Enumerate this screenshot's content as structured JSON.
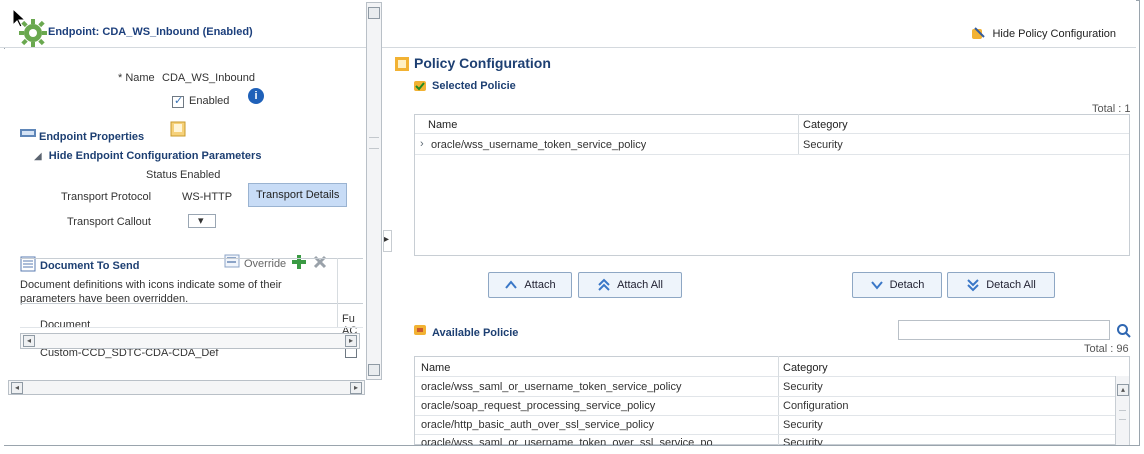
{
  "header": {
    "endpoint_title": "Endpoint: CDA_WS_Inbound (Enabled)",
    "hide_policy_label": "Hide Policy Configuration"
  },
  "left": {
    "name_label": "* Name",
    "name_value": "CDA_WS_Inbound",
    "enabled_label": "Enabled",
    "endpoint_properties": "Endpoint Properties",
    "hide_config": "Hide Endpoint Configuration Parameters",
    "status_label": "Status",
    "status_value": "Enabled",
    "transport_protocol_label": "Transport Protocol",
    "transport_protocol_value": "WS-HTTP",
    "transport_details": "Transport Details",
    "transport_callout_label": "Transport Callout",
    "document_to_send": "Document To Send",
    "override": "Override",
    "doc_desc_1": "Document definitions with icons indicate some of their",
    "doc_desc_2": "parameters have been overridden.",
    "doc_table": {
      "col_document": "Document",
      "col_fu_top": "Fu",
      "col_fu_bottom": "AC",
      "row_document": "Custom-CCD_SDTC-CDA-CDA_Def"
    }
  },
  "right": {
    "title": "Policy Configuration",
    "selected_title": "Selected Policie",
    "selected_total": "Total : 1",
    "selected_table": {
      "col_name": "Name",
      "col_category": "Category",
      "rows": [
        {
          "name": "oracle/wss_username_token_service_policy",
          "category": "Security"
        }
      ]
    },
    "buttons": {
      "attach": "Attach",
      "attach_all": "Attach All",
      "detach": "Detach",
      "detach_all": "Detach All"
    },
    "available_title": "Available Policie",
    "available_total": "Total : 96",
    "available_table": {
      "col_name": "Name",
      "col_category": "Category",
      "rows": [
        {
          "name": "oracle/wss_saml_or_username_token_service_policy",
          "category": "Security"
        },
        {
          "name": "oracle/soap_request_processing_service_policy",
          "category": "Configuration"
        },
        {
          "name": "oracle/http_basic_auth_over_ssl_service_policy",
          "category": "Security"
        },
        {
          "name": "oracle/wss_saml_or_username_token_over_ssl_service_po",
          "category": "Security"
        }
      ]
    }
  }
}
